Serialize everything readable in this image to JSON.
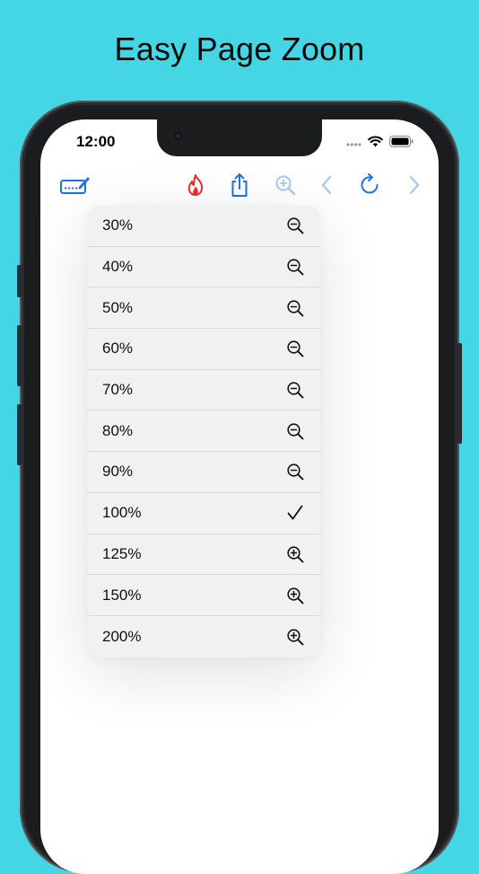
{
  "headline": "Easy Page Zoom",
  "status_bar": {
    "time": "12:00"
  },
  "toolbar": {
    "items": [
      {
        "name": "keyboard-edit-icon",
        "active": true
      },
      {
        "name": "flame-icon",
        "active": true
      },
      {
        "name": "share-icon",
        "active": true
      },
      {
        "name": "zoom-icon",
        "active": false
      },
      {
        "name": "back-icon",
        "active": false
      },
      {
        "name": "reload-icon",
        "active": true
      },
      {
        "name": "forward-icon",
        "active": false
      }
    ]
  },
  "zoom_menu": {
    "items": [
      {
        "label": "30%",
        "icon": "zoom-out-icon"
      },
      {
        "label": "40%",
        "icon": "zoom-out-icon"
      },
      {
        "label": "50%",
        "icon": "zoom-out-icon"
      },
      {
        "label": "60%",
        "icon": "zoom-out-icon"
      },
      {
        "label": "70%",
        "icon": "zoom-out-icon"
      },
      {
        "label": "80%",
        "icon": "zoom-out-icon"
      },
      {
        "label": "90%",
        "icon": "zoom-out-icon"
      },
      {
        "label": "100%",
        "icon": "checkmark-icon",
        "selected": true
      },
      {
        "label": "125%",
        "icon": "zoom-in-icon"
      },
      {
        "label": "150%",
        "icon": "zoom-in-icon"
      },
      {
        "label": "200%",
        "icon": "zoom-in-icon"
      }
    ]
  },
  "colors": {
    "background": "#45d6e6",
    "accent": "#1a73e8",
    "flame": "#e0312a",
    "disabled": "#a9c8f0"
  }
}
